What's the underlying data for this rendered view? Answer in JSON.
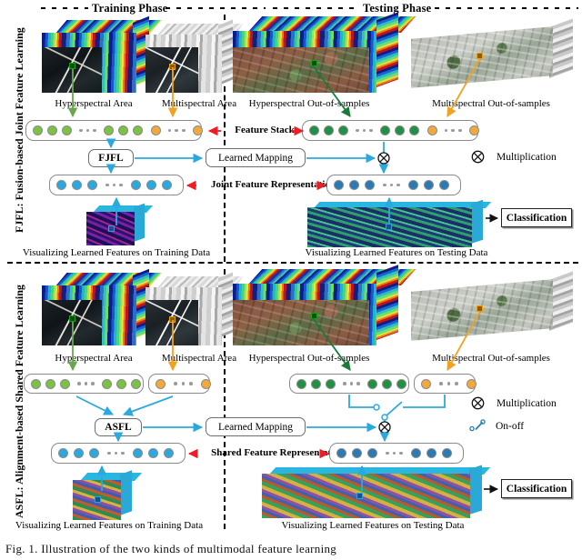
{
  "figure": {
    "caption": "Fig. 1.    Illustration of the two kinds of multimodal feature learning"
  },
  "headers": {
    "training_phase": "Training Phase",
    "testing_phase": "Testing Phase"
  },
  "side_labels": {
    "top": "FJFL: Fusion-based Joint Feature Learning",
    "bottom": "ASFL: Alignment-based Shared Feature Learning"
  },
  "legend": [
    {
      "icon": "multiplication-icon",
      "label": "Multiplication"
    },
    {
      "icon": "on-off-switch-icon",
      "label": "On-off"
    }
  ],
  "fjfl": {
    "training": {
      "image_captions": [
        "Hyperspectral Area",
        "Multispectral Area"
      ],
      "feature_stack_label": "Feature Stack",
      "method_box": "FJFL",
      "representation_label": "Joint Feature Representation",
      "visual_caption": "Visualizing Learned Features on Training Data",
      "stack": {
        "modal_a_dots": 6,
        "modal_a_color": "#7cc242",
        "modal_b_dots": 2,
        "modal_b_color": "#f2a93b"
      },
      "representation_dots": 6,
      "representation_color": "#2aa9e0"
    },
    "testing": {
      "image_captions": [
        "Hyperspectral Out-of-samples",
        "Multispectral Out-of-samples"
      ],
      "mapping_box": "Learned Mapping",
      "classification_box": "Classification",
      "visual_caption": "Visualizing Learned Features on Testing Data",
      "stack": {
        "modal_a_dots": 6,
        "modal_a_color": "#1f9142",
        "modal_b_dots": 2,
        "modal_b_color": "#f2a93b"
      },
      "representation_dots": 6,
      "representation_color": "#2a7ab5"
    }
  },
  "asfl": {
    "training": {
      "image_captions": [
        "Hyperspectral Area",
        "Multispectral Area"
      ],
      "method_box": "ASFL",
      "representation_label": "Shared Feature Representation",
      "visual_caption": "Visualizing Learned Features on Training Data",
      "stack_a_dots": 6,
      "stack_a_color": "#7cc242",
      "stack_b_dots": 2,
      "stack_b_color": "#f2a93b",
      "representation_dots": 6,
      "representation_color": "#2aa9e0"
    },
    "testing": {
      "image_captions": [
        "Hyperspectral Out-of-samples",
        "Multispectral Out-of-samples"
      ],
      "mapping_box": "Learned Mapping",
      "classification_box": "Classification",
      "visual_caption": "Visualizing Learned Features on Testing Data",
      "stack_a_dots": 6,
      "stack_a_color": "#1f9142",
      "stack_b_dots": 2,
      "stack_b_color": "#f2a93b",
      "representation_dots": 6,
      "representation_color": "#2a7ab5"
    }
  },
  "colors": {
    "flow_blue": "#2aa9e0",
    "annot_red": "#ee1c24",
    "green_arrow": "#6aa84f",
    "dark_green_arrow": "#1a7a3a",
    "orange_arrow": "#f0a220",
    "cube_cyan": "#2aa8d8"
  }
}
